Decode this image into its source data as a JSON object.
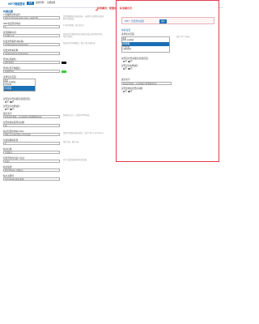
{
  "topbar": {
    "brand": "WP7略缩登录",
    "tabs": [
      "设置",
      "插件管理",
      "功能配置"
    ],
    "active_index": 0
  },
  "left": {
    "section_title": "快捷设置",
    "fields": [
      {
        "label": "1.隐藏登录验证码:",
        "value": "[Docurl/plugins/wp_login_captcha]",
        "hint": "是否隐藏登录页面验证码，以便用户无需填写验证码即可完成登录。"
      },
      {
        "label": "WP7短链登录地址:",
        "value": "0",
        "hint": "0 代表不限制，默认值为0。"
      },
      {
        "label": "延迟跳转时间:",
        "value": "3,000 ms",
        "hint": "登录成功后跳转到首页或指定页面之前的等待时间，单位为毫秒。"
      },
      {
        "label": "短链文件路径(非必填):",
        "value": "/data/wwwroot/example",
        "hint": "短链文件的存储路径，默认为站点根目录。"
      },
      {
        "label": "短链文件夹名称:",
        "value": "/data/wwwroot/example",
        "hint": ""
      },
      {
        "label": "登录标签颜色:",
        "value": "#FF0000",
        "hint": "",
        "swatch": "#111111"
      },
      {
        "label": "登录标签字体颜色:",
        "value": "#00FF00",
        "hint": "",
        "swatch": "#33cc33"
      }
    ],
    "list_label": "选择显示页面:",
    "list_items": [
      "首页",
      "首页 文章列表",
      "分类页面",
      "标签页面",
      "作者页面",
      "日期归档页",
      "搜索结果页",
      "404页面"
    ],
    "list_selected": [
      3,
      4
    ],
    "radio_groups": [
      {
        "label": "是否显示登录按钮(仅限首页):",
        "options": [
          "是",
          "否"
        ],
        "selected": 0
      },
      {
        "label": "是否显示在侧边栏:",
        "options": [
          "是",
          "否"
        ],
        "selected": 0
      }
    ],
    "tail_fields": [
      {
        "label": "提示文字:",
        "value": "您还没有登录，点击登录后可查看更多内容",
        "hint": "登录提示文字，可使用HTML标签。"
      },
      {
        "label": "是否启用短链登录功能:",
        "value": "是",
        "hint": ""
      },
      {
        "label": "站点短链接地址(URL):",
        "value": "http://s.example.com/login",
        "hint": "请填写完整的短链接地址，包括 http:// 或 https://。"
      },
      {
        "label": "短链接跳转延迟:",
        "value": "3",
        "hint": "单位为秒，默认3秒。"
      },
      {
        "label": "站点标题:",
        "value": "示例站点",
        "hint": ""
      },
      {
        "label": "短链登录的自定义标识:",
        "value": "login",
        "hint": "用于生成短链登录地址的后缀。"
      },
      {
        "label": "站点描述:",
        "value": "WordPress 示例站点",
        "hint": ""
      },
      {
        "label": "站点关键词:",
        "value": "wordpress,登录,短链",
        "hint": ""
      }
    ]
  },
  "callout": {
    "text": "标准模式，配置后自动设置完成"
  },
  "preview": {
    "title": "标准模式页",
    "bar_text": "WP7 - 短链登录设置",
    "bar_button": "保存",
    "section": "快捷设置",
    "list_label": "选择显示页面:",
    "list_items": [
      "首页",
      "首页 文章列表",
      "分类页面",
      "标签页面",
      "作者页面",
      "日期归档页"
    ],
    "list_selected": [
      2,
      3
    ],
    "list_hint": "按住 Ctrl 可多选",
    "radio_groups": [
      {
        "label": "是否显示登录按钮(仅限首页):",
        "options": [
          "是",
          "否"
        ],
        "selected": 0
      },
      {
        "label": "是否显示在侧边栏:",
        "options": [
          "是",
          "否"
        ],
        "selected": 0
      }
    ],
    "text_label": "提示文字:",
    "text_value": "您还没有登录，点击登录后可查看更多内容",
    "last_label": "是否启用短链登录功能:",
    "last_options": [
      "是",
      "否"
    ],
    "last_selected": 0
  },
  "colors": {
    "brand": "#1a6fb5",
    "accent_red": "#e33b4a"
  }
}
